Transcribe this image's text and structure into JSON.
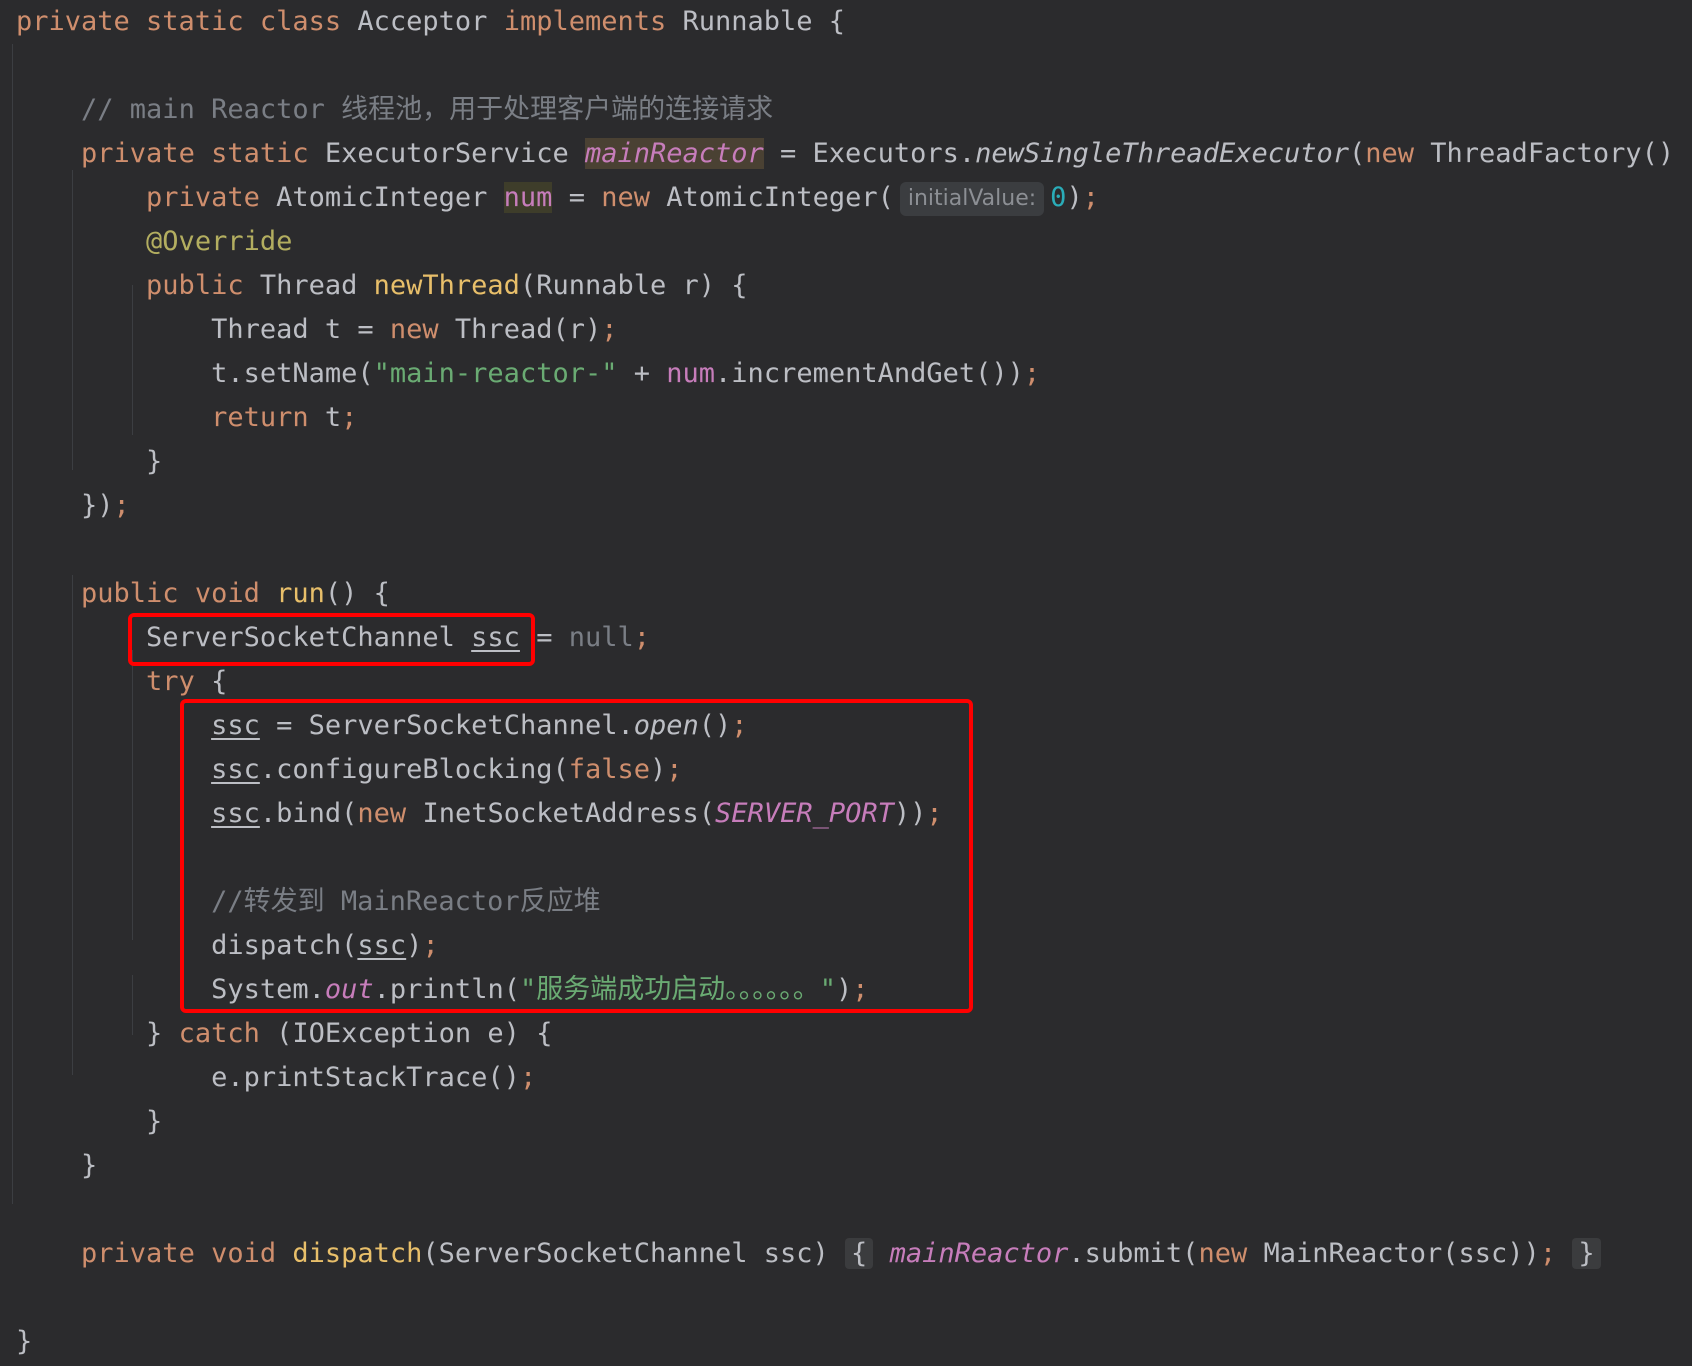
{
  "lines": [
    {
      "segments": [
        [
          "kw",
          "private static class "
        ],
        [
          "",
          "Acceptor "
        ],
        [
          "kw",
          "implements "
        ],
        [
          "",
          "Runnable {"
        ]
      ]
    },
    {
      "segments": []
    },
    {
      "segments": [
        [
          "",
          "    "
        ],
        [
          "cmt",
          "// main Reactor 线程池，用于处理客户端的连接请求"
        ]
      ]
    },
    {
      "segments": [
        [
          "",
          "    "
        ],
        [
          "kw",
          "private static "
        ],
        [
          "",
          "ExecutorService "
        ],
        [
          "fld itf hl-field",
          "mainReactor"
        ],
        [
          "",
          " = Executors."
        ],
        [
          "itf",
          "newSingleThreadExecutor"
        ],
        [
          "",
          "("
        ],
        [
          "kw",
          "new "
        ],
        [
          "",
          "ThreadFactory() {"
        ]
      ]
    },
    {
      "segments": [
        [
          "",
          "        "
        ],
        [
          "kw",
          "private "
        ],
        [
          "",
          "AtomicInteger "
        ],
        [
          "fld hl-num",
          "num"
        ],
        [
          "",
          " = "
        ],
        [
          "kw",
          "new "
        ],
        [
          "",
          "AtomicInteger("
        ],
        [
          "hint",
          "initialValue:"
        ],
        [
          "num",
          "0"
        ],
        [
          "",
          ")"
        ],
        [
          "punc",
          ";"
        ]
      ]
    },
    {
      "segments": [
        [
          "",
          "        "
        ],
        [
          "ann",
          "@Override"
        ]
      ]
    },
    {
      "segments": [
        [
          "",
          "        "
        ],
        [
          "kw",
          "public "
        ],
        [
          "",
          "Thread "
        ],
        [
          "fn-decl",
          "newThread"
        ],
        [
          "",
          "(Runnable r) {"
        ]
      ]
    },
    {
      "segments": [
        [
          "",
          "            "
        ],
        [
          "",
          "Thread t = "
        ],
        [
          "kw",
          "new "
        ],
        [
          "",
          "Thread(r)"
        ],
        [
          "punc",
          ";"
        ]
      ]
    },
    {
      "segments": [
        [
          "",
          "            "
        ],
        [
          "",
          "t.setName("
        ],
        [
          "str",
          "\"main-reactor-\""
        ],
        [
          "",
          " + "
        ],
        [
          "fld",
          "num"
        ],
        [
          "",
          ".incrementAndGet())"
        ],
        [
          "punc",
          ";"
        ]
      ]
    },
    {
      "segments": [
        [
          "",
          "            "
        ],
        [
          "kw",
          "return "
        ],
        [
          "",
          "t"
        ],
        [
          "punc",
          ";"
        ]
      ]
    },
    {
      "segments": [
        [
          "",
          "        "
        ],
        [
          "",
          "}"
        ]
      ]
    },
    {
      "segments": [
        [
          "",
          "    "
        ],
        [
          "",
          "})"
        ],
        [
          "punc",
          ";"
        ]
      ]
    },
    {
      "segments": []
    },
    {
      "segments": [
        [
          "",
          "    "
        ],
        [
          "kw",
          "public void "
        ],
        [
          "fn-decl",
          "run"
        ],
        [
          "",
          "() {"
        ]
      ]
    },
    {
      "segments": [
        [
          "",
          "        "
        ],
        [
          "",
          "ServerSocketChannel "
        ],
        [
          "ul",
          "ssc"
        ],
        [
          "",
          " = "
        ],
        [
          "null",
          "null"
        ],
        [
          "punc",
          ";"
        ]
      ]
    },
    {
      "segments": [
        [
          "",
          "        "
        ],
        [
          "kw",
          "try "
        ],
        [
          "",
          "{"
        ]
      ]
    },
    {
      "segments": [
        [
          "",
          "            "
        ],
        [
          "ul",
          "ssc"
        ],
        [
          "",
          " = ServerSocketChannel."
        ],
        [
          "itf",
          "open"
        ],
        [
          "",
          "()"
        ],
        [
          "punc",
          ";"
        ]
      ]
    },
    {
      "segments": [
        [
          "",
          "            "
        ],
        [
          "ul",
          "ssc"
        ],
        [
          "",
          ".configureBlocking("
        ],
        [
          "kw",
          "false"
        ],
        [
          "",
          ")"
        ],
        [
          "punc",
          ";"
        ]
      ]
    },
    {
      "segments": [
        [
          "",
          "            "
        ],
        [
          "ul",
          "ssc"
        ],
        [
          "",
          ".bind("
        ],
        [
          "kw",
          "new "
        ],
        [
          "",
          "InetSocketAddress("
        ],
        [
          "fld itf",
          "SERVER_PORT"
        ],
        [
          "",
          "))"
        ],
        [
          "punc",
          ";"
        ]
      ]
    },
    {
      "segments": []
    },
    {
      "segments": [
        [
          "",
          "            "
        ],
        [
          "cmt",
          "//转发到 MainReactor反应堆"
        ]
      ]
    },
    {
      "segments": [
        [
          "",
          "            "
        ],
        [
          "",
          "dispatch("
        ],
        [
          "ul",
          "ssc"
        ],
        [
          "",
          ")"
        ],
        [
          "punc",
          ";"
        ]
      ]
    },
    {
      "segments": [
        [
          "",
          "            "
        ],
        [
          "",
          "System."
        ],
        [
          "fld itf",
          "out"
        ],
        [
          "",
          ".println("
        ],
        [
          "str",
          "\"服务端成功启动。。。。。。\""
        ],
        [
          "",
          ")"
        ],
        [
          "punc",
          ";"
        ]
      ]
    },
    {
      "segments": [
        [
          "",
          "        "
        ],
        [
          "",
          "} "
        ],
        [
          "kw",
          "catch "
        ],
        [
          "",
          "(IOException e) {"
        ]
      ]
    },
    {
      "segments": [
        [
          "",
          "            "
        ],
        [
          "",
          "e.printStackTrace()"
        ],
        [
          "punc",
          ";"
        ]
      ]
    },
    {
      "segments": [
        [
          "",
          "        "
        ],
        [
          "",
          "}"
        ]
      ]
    },
    {
      "segments": [
        [
          "",
          "    "
        ],
        [
          "",
          "}"
        ]
      ]
    },
    {
      "segments": []
    },
    {
      "segments": [
        [
          "",
          "    "
        ],
        [
          "kw",
          "private void "
        ],
        [
          "fn-decl",
          "dispatch"
        ],
        [
          "",
          "(ServerSocketChannel ssc) "
        ],
        [
          "fold",
          "{"
        ],
        [
          "",
          " "
        ],
        [
          "fld itf",
          "mainReactor"
        ],
        [
          "",
          ".submit("
        ],
        [
          "kw",
          "new "
        ],
        [
          "",
          "MainReactor(ssc))"
        ],
        [
          "punc",
          ";"
        ],
        [
          "",
          " "
        ],
        [
          "fold",
          "}"
        ]
      ]
    },
    {
      "segments": []
    },
    {
      "segments": [
        [
          "",
          "}"
        ]
      ]
    }
  ],
  "annotations": [
    {
      "label": "declaration-highlight"
    },
    {
      "label": "try-body-highlight"
    }
  ],
  "colors": {
    "background": "#2b2b2d",
    "highlight_box": "#ff0000"
  }
}
